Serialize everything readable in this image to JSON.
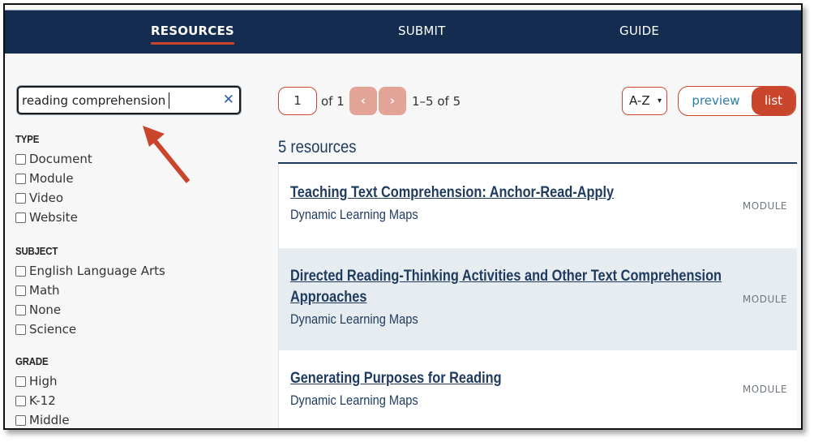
{
  "nav": {
    "items": [
      {
        "label": "RESOURCES",
        "active": true
      },
      {
        "label": "SUBMIT",
        "active": false
      },
      {
        "label": "GUIDE",
        "active": false
      }
    ],
    "active_underline_color": "#c9452b",
    "background_color": "#132c50"
  },
  "search": {
    "value": "reading comprehension",
    "clear_icon": "close-icon"
  },
  "annotation": {
    "type": "arrow",
    "color": "#c9452b",
    "points_to": "search-input"
  },
  "facets": [
    {
      "title": "TYPE",
      "options": [
        "Document",
        "Module",
        "Video",
        "Website"
      ]
    },
    {
      "title": "SUBJECT",
      "options": [
        "English Language Arts",
        "Math",
        "None",
        "Science"
      ]
    },
    {
      "title": "GRADE",
      "options": [
        "High",
        "K-12",
        "Middle"
      ]
    }
  ],
  "pager": {
    "current_page": "1",
    "of_label": "of 1",
    "prev_icon": "chevron-left-icon",
    "next_icon": "chevron-right-icon",
    "range_label": "1–5 of 5"
  },
  "sort": {
    "selected": "A-Z"
  },
  "view_toggle": {
    "preview_label": "preview",
    "list_label": "list",
    "active": "list"
  },
  "results": {
    "count_label": "5 resources",
    "items": [
      {
        "title": "Teaching Text Comprehension: Anchor-Read-Apply",
        "source": "Dynamic Learning Maps",
        "type": "MODULE"
      },
      {
        "title": "Directed Reading-Thinking Activities and Other Text Comprehension Approaches",
        "source": "Dynamic Learning Maps",
        "type": "MODULE"
      },
      {
        "title": "Generating Purposes for Reading",
        "source": "Dynamic Learning Maps",
        "type": "MODULE"
      }
    ]
  },
  "colors": {
    "accent": "#c9452b",
    "navy": "#1e3a5f",
    "link_blue": "#2b7cab",
    "pager_disabled": "#e2a496"
  }
}
